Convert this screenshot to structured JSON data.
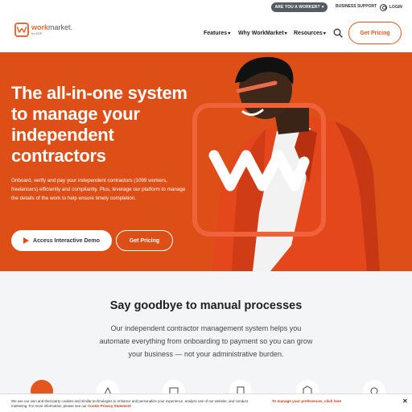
{
  "topbar": {
    "worker_label": "ARE YOU A WORKER?",
    "support_label": "BUSINESS SUPPORT",
    "login_label": "LOGIN"
  },
  "logo": {
    "word_brand": "work",
    "word_rest": "market.",
    "sub": "by ADP"
  },
  "nav": {
    "items": [
      {
        "label": "Features"
      },
      {
        "label": "Why WorkMarket"
      },
      {
        "label": "Resources"
      }
    ],
    "cta": "Get Pricing",
    "chevron": "▾"
  },
  "hero": {
    "title": "The all-in-one system to manage your independent contractors",
    "body": "Onboard, verify and pay your independent contractors (1099 workers, freelancers) efficiently and compliantly. Plus, leverage our platform to manage the details of the work to help ensure timely completion.",
    "demo_button": "Access Interactive Demo",
    "pricing_button": "Get Pricing",
    "bg_color": "#dd4f17"
  },
  "section": {
    "title": "Say goodbye to manual processes",
    "body": "Our independent contractor management system helps you automate everything from onboarding to payment so you can grow your business — not your administrative burden."
  },
  "cookie": {
    "text": "We use our own and third-party cookies and similar technologies to enhance and personalize your experience, analyze use of our website, and conduct marketing. For more information, please see our",
    "link": "Cookie Privacy Statement",
    "manage": "To manage your preferences, click here",
    "close": "✕"
  },
  "colors": {
    "accent": "#e2571f",
    "dark_pill": "#555a63"
  }
}
